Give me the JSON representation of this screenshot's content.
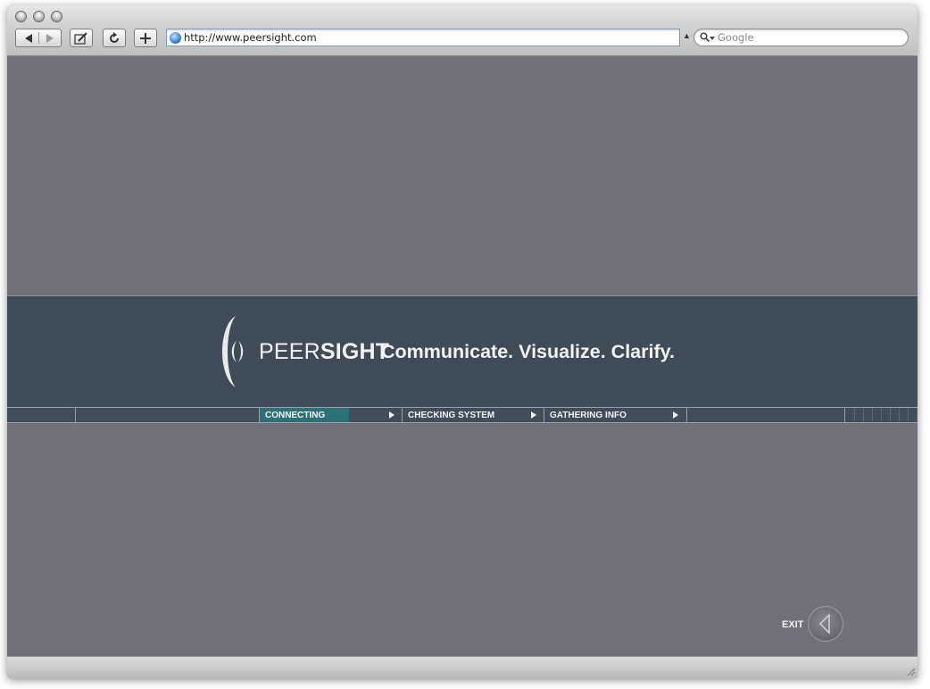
{
  "browser": {
    "url": "http://www.peersight.com",
    "search_placeholder": "Google",
    "icons": {
      "back": "back-arrow-icon",
      "forward": "forward-arrow-icon",
      "edit": "edit-icon",
      "reload": "reload-icon",
      "add": "plus-icon",
      "site": "globe-icon",
      "search": "search-icon"
    }
  },
  "page": {
    "brand_light": "PEER",
    "brand_bold": "SIGHT",
    "tagline": "Communicate. Visualize. Clarify.",
    "steps": [
      {
        "label": "CONNECTING",
        "active": true,
        "progress": 0.63
      },
      {
        "label": "CHECKING SYSTEM",
        "active": false,
        "progress": 0
      },
      {
        "label": "GATHERING INFO",
        "active": false,
        "progress": 0
      }
    ],
    "exit_label": "EXIT"
  },
  "colors": {
    "page_background": "#727079",
    "banner_background": "#404b58",
    "progress_active": "#2d7178",
    "text_light": "#f4f4f4"
  }
}
